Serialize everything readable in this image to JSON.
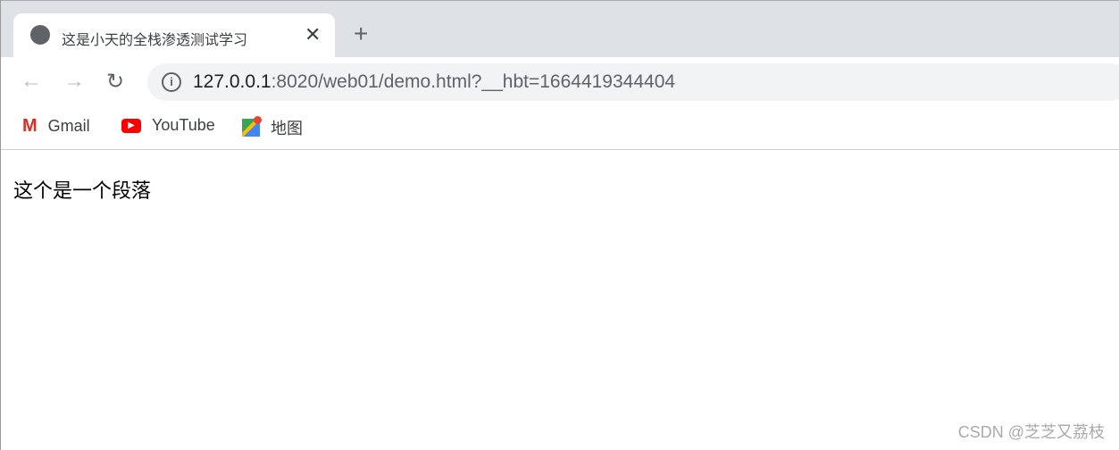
{
  "tab": {
    "title": "这是小天的全栈渗透测试学习",
    "icon": "globe-icon"
  },
  "address": {
    "host": "127.0.0.1",
    "rest": ":8020/web01/demo.html?__hbt=1664419344404"
  },
  "bookmarks": [
    {
      "label": "Gmail",
      "icon": "gmail-icon"
    },
    {
      "label": "YouTube",
      "icon": "youtube-icon"
    },
    {
      "label": "地图",
      "icon": "maps-icon"
    }
  ],
  "content": {
    "paragraph": "这个是一个段落"
  },
  "watermark": "CSDN @芝芝又荔枝"
}
